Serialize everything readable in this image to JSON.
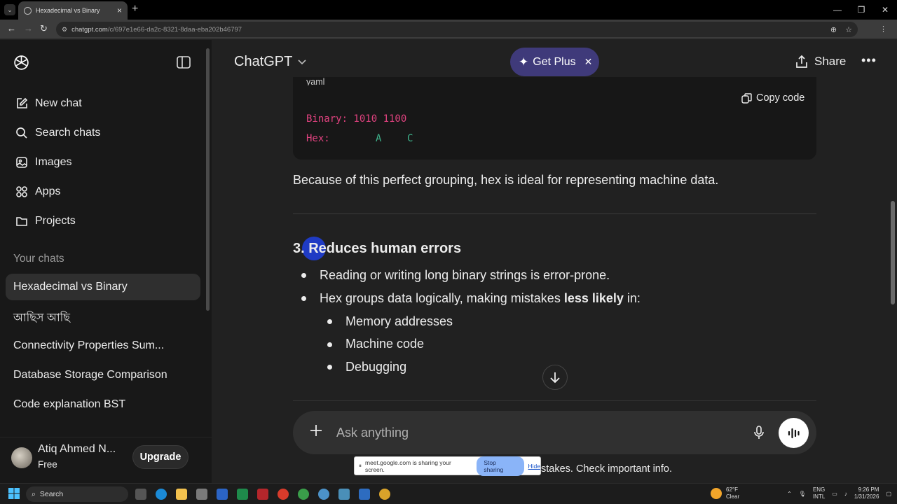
{
  "browser": {
    "tab_title": "Hexadecimal vs Binary",
    "new_tab": "+",
    "url_host": "chatgpt.com",
    "url_path": "/c/697e1e66-da2c-8321-8daa-eba202b46797"
  },
  "sidebar": {
    "nav": [
      {
        "label": "New chat",
        "icon": "edit-icon"
      },
      {
        "label": "Search chats",
        "icon": "search-icon"
      },
      {
        "label": "Images",
        "icon": "image-icon"
      },
      {
        "label": "Apps",
        "icon": "apps-icon"
      },
      {
        "label": "Projects",
        "icon": "folder-icon"
      }
    ],
    "section_title": "Your chats",
    "chats": [
      "Hexadecimal vs Binary",
      "আছিস আছি",
      "Connectivity Properties Sum...",
      "Database Storage Comparison",
      "Code explanation BST"
    ],
    "user_name": "Atiq Ahmed N...",
    "user_plan": "Free",
    "upgrade_label": "Upgrade"
  },
  "header": {
    "model": "ChatGPT",
    "get_plus": "Get Plus",
    "share": "Share"
  },
  "content": {
    "code_lang": "yaml",
    "copy_code": "Copy code",
    "code_line_1": "Binary: 1010 1100",
    "code_line_2_label": "Hex:",
    "code_hex_a": "A",
    "code_hex_c": "C",
    "paragraph": "Because of this perfect grouping, hex is ideal for representing machine data.",
    "heading": "3. Reduces human errors",
    "bullet_1": "Reading or writing long binary strings is error-prone.",
    "bullet_2_prefix": "Hex groups data logically, making mistakes ",
    "bullet_2_bold": "less likely",
    "bullet_2_suffix": " in:",
    "sub_bullets": [
      "Memory addresses",
      "Machine code",
      "Debugging"
    ]
  },
  "composer": {
    "placeholder": "Ask anything",
    "disclaimer_tail": "stakes. Check important info."
  },
  "screen_share": {
    "message": "meet.google.com is sharing your screen.",
    "stop": "Stop sharing",
    "hide": "Hide"
  },
  "taskbar": {
    "search": "Search",
    "temp": "62°F",
    "condition": "Clear",
    "lang_1": "ENG",
    "lang_2": "INTL",
    "time": "9:26 PM",
    "date": "1/31/2026"
  }
}
